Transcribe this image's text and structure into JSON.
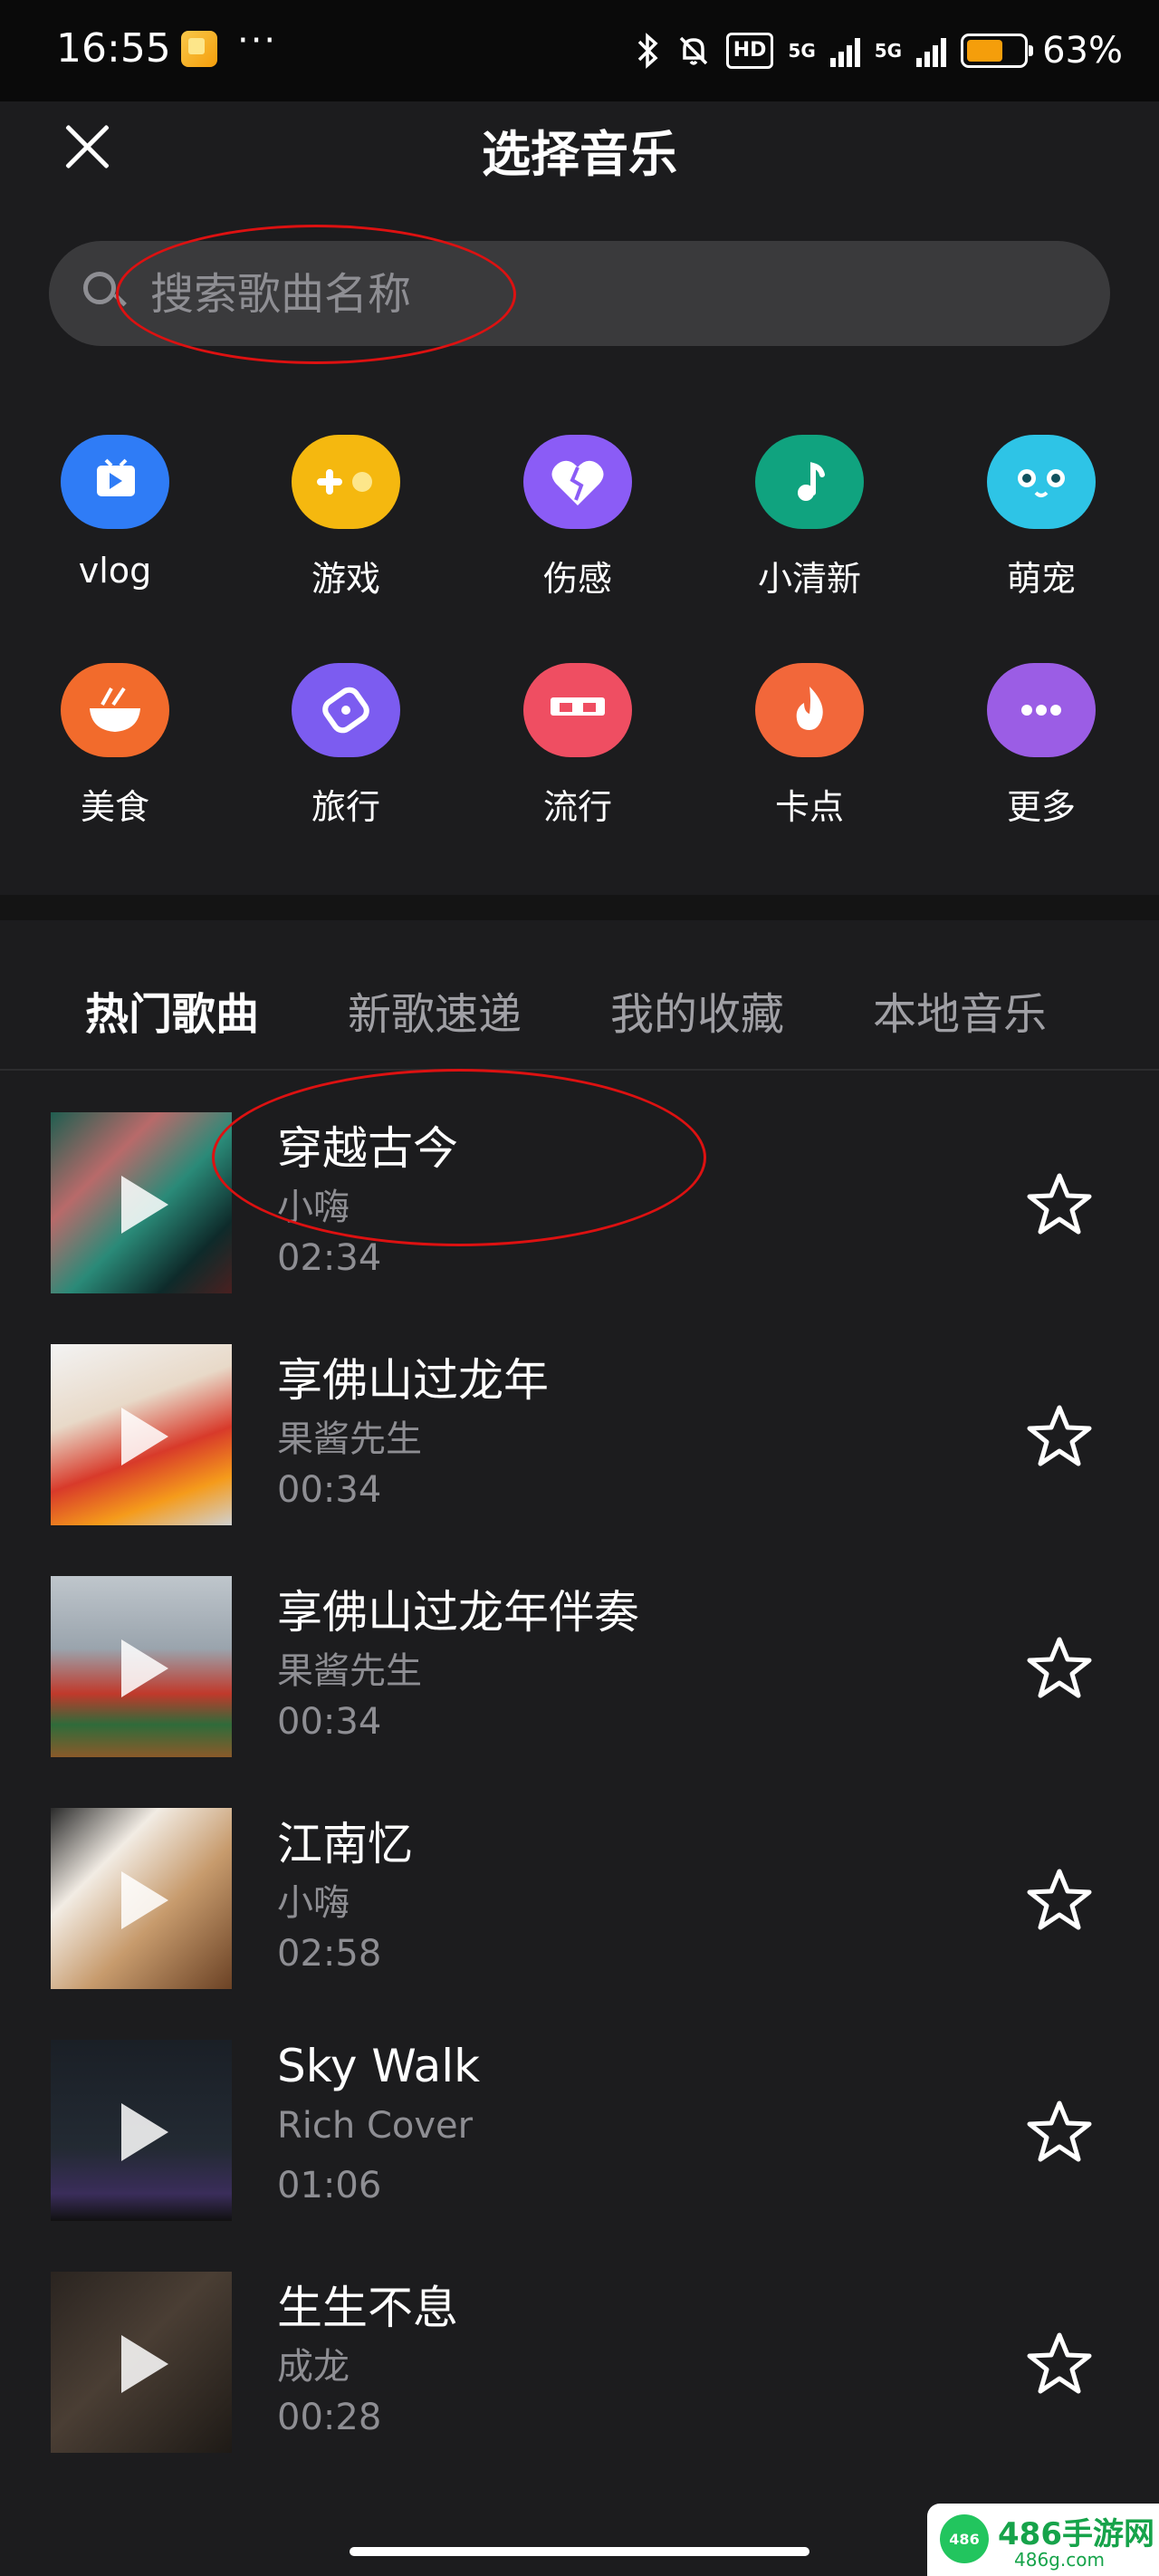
{
  "status_bar": {
    "time": "16:55",
    "more": "···",
    "hd_badge": "HD",
    "net1": "5G",
    "net2": "5G",
    "battery_level": 0.63,
    "battery_pct": "63%"
  },
  "header": {
    "title": "选择音乐"
  },
  "search": {
    "placeholder": "搜索歌曲名称"
  },
  "categories": [
    {
      "label": "vlog",
      "color": "#2f7cf6",
      "icon": "vlog-icon"
    },
    {
      "label": "游戏",
      "color": "#f5b80f",
      "icon": "game-icon"
    },
    {
      "label": "伤感",
      "color": "#8b5cf6",
      "icon": "broken-heart-icon"
    },
    {
      "label": "小清新",
      "color": "#10a37f",
      "icon": "music-note-icon"
    },
    {
      "label": "萌宠",
      "color": "#2ec4e6",
      "icon": "pet-face-icon"
    },
    {
      "label": "美食",
      "color": "#f26b2c",
      "icon": "bowl-icon"
    },
    {
      "label": "旅行",
      "color": "#7c5cf0",
      "icon": "travel-icon"
    },
    {
      "label": "流行",
      "color": "#ef4e62",
      "icon": "sunglasses-icon"
    },
    {
      "label": "卡点",
      "color": "#f2673a",
      "icon": "flame-icon"
    },
    {
      "label": "更多",
      "color": "#9b5de5",
      "icon": "more-dots-icon"
    }
  ],
  "tabs": [
    {
      "label": "热门歌曲",
      "active": true
    },
    {
      "label": "新歌速递",
      "active": false
    },
    {
      "label": "我的收藏",
      "active": false
    },
    {
      "label": "本地音乐",
      "active": false
    }
  ],
  "songs": [
    {
      "title": "穿越古今",
      "artist": "小嗨",
      "duration": "02:34",
      "cover": "linear-gradient(135deg,#1f5e50 0%,#b86a6a 30%,#2a8a78 55%,#0e2a2a 80%,#4a2020 100%)"
    },
    {
      "title": "享佛山过龙年",
      "artist": "果酱先生",
      "duration": "00:34",
      "cover": "linear-gradient(160deg,#f3f3f3 0%,#e8d9c8 35%,#d83a2a 60%,#f59b1b 80%,#d0d0d0 100%)"
    },
    {
      "title": "享佛山过龙年伴奏",
      "artist": "果酱先生",
      "duration": "00:34",
      "cover": "linear-gradient(180deg,#bfc6cc 0%,#9aa4ad 40%,#c0392b 65%,#2f6b3a 82%,#8a5a2a 100%)"
    },
    {
      "title": "江南忆",
      "artist": "小嗨",
      "duration": "02:58",
      "cover": "linear-gradient(135deg,#2a2a2a 0%,#f2ece4 30%,#c79b6d 60%,#6b4225 100%)"
    },
    {
      "title": "Sky Walk",
      "artist": "Rich Cover",
      "duration": "01:06",
      "cover": "linear-gradient(180deg,#1a1f26 0%,#232a33 60%,#3a2d5a 85%,#111 100%)"
    },
    {
      "title": "生生不息",
      "artist": "成龙",
      "duration": "00:28",
      "cover": "linear-gradient(135deg,#2a2420 0%,#4a3e34 45%,#1e1a16 100%)"
    }
  ],
  "watermark": {
    "logo": "486",
    "text": "486手游网",
    "sub": "486g.com"
  }
}
